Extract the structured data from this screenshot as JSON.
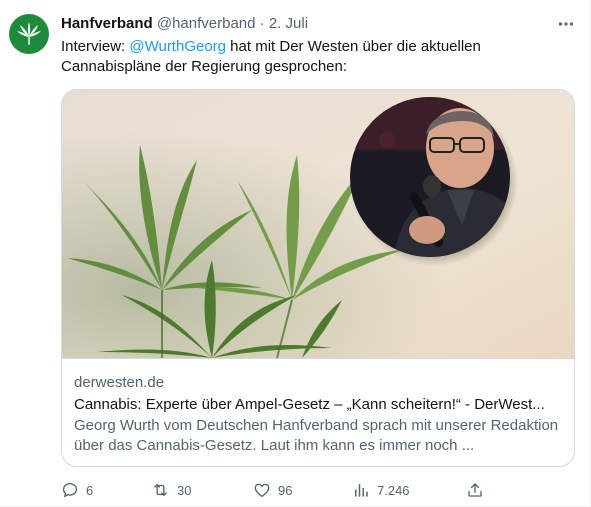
{
  "author": {
    "name": "Hanfverband",
    "handle": "@hanfverband",
    "separator": "·",
    "date": "2. Juli",
    "avatar_color": "#1f8a3c"
  },
  "tweet": {
    "text_before": "Interview: ",
    "mention": "@WurthGeorg",
    "text_after": " hat mit Der Westen über die aktuellen Cannabispläne der Regierung gesprochen:"
  },
  "card": {
    "domain": "derwesten.de",
    "title": "Cannabis: Experte über Ampel-Gesetz – „Kann scheitern!“ - DerWest...",
    "description": "Georg Wurth vom Deutschen Hanfverband sprach mit unserer Redaktion über das Cannabis-Gesetz. Laut ihm kann es immer noch ..."
  },
  "actions": {
    "replies": "6",
    "retweets": "30",
    "likes": "96",
    "views": "7.246"
  },
  "icons": [
    "cannabis-leaf-icon",
    "more-icon",
    "reply-icon",
    "retweet-icon",
    "like-icon",
    "views-icon",
    "share-icon"
  ],
  "colors": {
    "link": "#1d9bf0",
    "secondary_text": "#536471",
    "border": "#cfd9de"
  }
}
